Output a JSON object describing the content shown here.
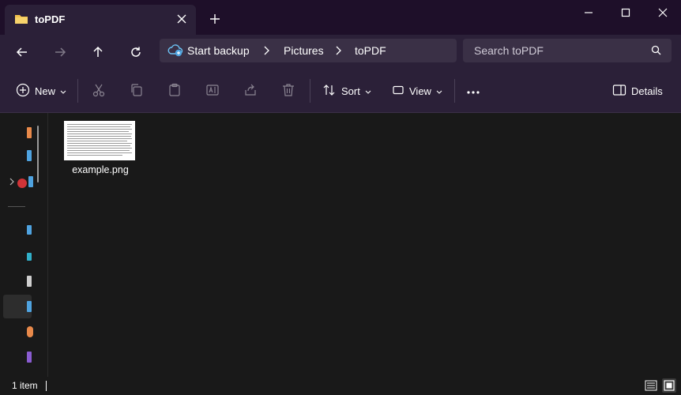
{
  "window": {
    "tab_title": "toPDF",
    "icons": {
      "tab": "folder-icon",
      "close_tab": "close-icon",
      "new_tab": "plus-icon",
      "minimize": "minimize-icon",
      "maximize": "maximize-icon",
      "close": "close-icon"
    }
  },
  "navigation": {
    "icons": [
      "arrow-left-icon",
      "arrow-right-icon",
      "arrow-up-icon",
      "refresh-icon"
    ],
    "breadcrumb": [
      "Start backup",
      "Pictures",
      "toPDF"
    ],
    "breadcrumb_icon": "cloud-backup-icon",
    "search_placeholder": "Search toPDF"
  },
  "toolbar": {
    "new_label": "New",
    "sort_label": "Sort",
    "view_label": "View",
    "details_label": "Details",
    "more_icon": "ellipsis-icon",
    "action_icons": [
      "cut-icon",
      "copy-icon",
      "paste-icon",
      "rename-icon",
      "share-icon",
      "delete-icon"
    ]
  },
  "files": [
    {
      "name": "example.png",
      "type": "image"
    }
  ],
  "status": {
    "count": "1 item"
  },
  "colors": {
    "titlebar": "#1e0f29",
    "chrome": "#2b2038",
    "field": "#3a3046",
    "content": "#191919",
    "folder": "#f2c14e",
    "accent_blue": "#4fa3e0"
  }
}
